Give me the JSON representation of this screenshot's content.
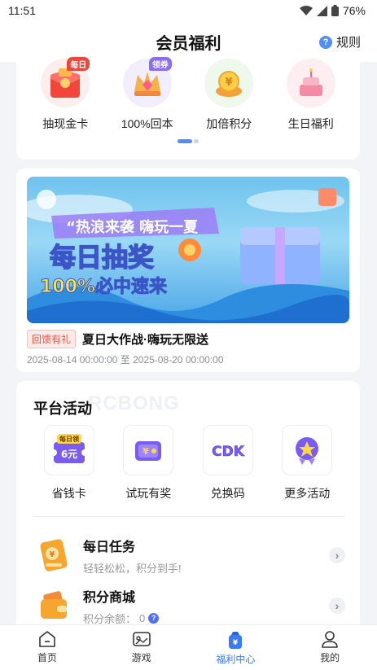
{
  "status": {
    "time": "11:51",
    "battery": "76%"
  },
  "nav": {
    "title": "会员福利",
    "rules_label": "规则"
  },
  "perks": [
    {
      "label": "抽现金卡",
      "badge": "每日",
      "icon": "red-envelope-icon",
      "badge_color": "#f0453a"
    },
    {
      "label": "100%回本",
      "badge": "领券",
      "icon": "crown-icon",
      "badge_color": "#8a6cf5"
    },
    {
      "label": "加倍积分",
      "badge": "",
      "icon": "gold-coin-icon",
      "badge_color": ""
    },
    {
      "label": "生日福利",
      "badge": "",
      "icon": "birthday-cake-icon",
      "badge_color": ""
    }
  ],
  "promo": {
    "banner_heading": "“热浪来袭 嗨玩一夏",
    "banner_main": "每日抽奖",
    "banner_sub": "100%必中速来",
    "tag": "回馈有礼",
    "title": "夏日大作战·嗨玩无限送",
    "date_range": "2025-08-14 00:00:00 至 2025-08-20 00:00:00"
  },
  "platform": {
    "title": "平台活动",
    "watermark": "RCBONG",
    "activities": [
      {
        "label": "省钱卡",
        "icon": "coupon-card-icon",
        "badge": "每日领",
        "amount": "6元"
      },
      {
        "label": "试玩有奖",
        "icon": "game-coin-icon"
      },
      {
        "label": "兑换码",
        "icon": "cdk-icon",
        "text": "CDK"
      },
      {
        "label": "更多活动",
        "icon": "star-medal-icon"
      }
    ],
    "tasks": [
      {
        "title": "每日任务",
        "subtitle": "轻轻松松，积分到手!",
        "icon": "task-ticket-icon"
      },
      {
        "title": "积分商城",
        "subtitle_prefix": "积分余额：",
        "balance": "0",
        "icon": "wallet-icon"
      }
    ]
  },
  "tabs": [
    {
      "label": "首页",
      "icon": "home-icon",
      "active": false
    },
    {
      "label": "游戏",
      "icon": "game-icon",
      "active": false
    },
    {
      "label": "福利中心",
      "icon": "welfare-bag-icon",
      "active": true
    },
    {
      "label": "我的",
      "icon": "profile-icon",
      "active": false
    }
  ],
  "colors": {
    "accent": "#3a7bf3",
    "promo_tag": "#e8594b",
    "background": "#f3f4f7"
  }
}
